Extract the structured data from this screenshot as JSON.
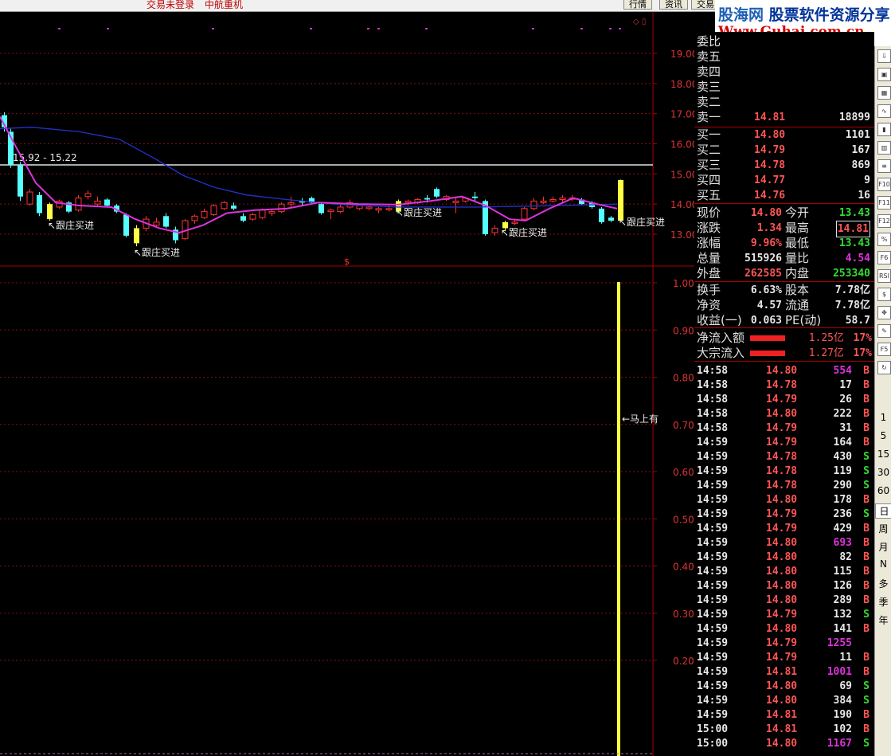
{
  "topbar": {
    "status_text": "交易未登录",
    "stock_name": "中航重机",
    "buttons": [
      "行情",
      "资讯",
      "交易"
    ]
  },
  "watermark": {
    "brand": "股海网",
    "slogan": "股票软件资源分享",
    "url": "Www.Guhai.com.cn"
  },
  "chart_data": [
    {
      "type": "candlestick",
      "yaxis_ticks": [
        "19.00",
        "18.00",
        "17.00",
        "16.00",
        "15.00",
        "14.00",
        "13.00"
      ],
      "ylim": [
        12.2,
        20.0
      ],
      "range_label": "15.92 - 15.22",
      "annotations": [
        "跟庄买进",
        "跟庄买进",
        "跟庄买进",
        "跟庄买进",
        "跟庄买进"
      ],
      "dollar_mark": "$"
    },
    {
      "type": "bar",
      "yaxis_ticks": [
        "1.00",
        "0.90",
        "0.80",
        "0.70",
        "0.60",
        "0.50",
        "0.40",
        "0.30",
        "0.20"
      ],
      "ylim": [
        0,
        1.05
      ],
      "signal_value": 1.0,
      "annotation": "←马上有"
    }
  ],
  "quote": {
    "header_label": "委比",
    "sells": [
      {
        "label": "卖五",
        "price": "",
        "vol": ""
      },
      {
        "label": "卖四",
        "price": "",
        "vol": ""
      },
      {
        "label": "卖三",
        "price": "",
        "vol": ""
      },
      {
        "label": "卖二",
        "price": "",
        "vol": ""
      },
      {
        "label": "卖一",
        "price": "14.81",
        "vol": "18899"
      }
    ],
    "buys": [
      {
        "label": "买一",
        "price": "14.80",
        "vol": "1101"
      },
      {
        "label": "买二",
        "price": "14.79",
        "vol": "167"
      },
      {
        "label": "买三",
        "price": "14.78",
        "vol": "869"
      },
      {
        "label": "买四",
        "price": "14.77",
        "vol": "9"
      },
      {
        "label": "买五",
        "price": "14.76",
        "vol": "16"
      }
    ],
    "stats": [
      {
        "l1": "现价",
        "v1": "14.80",
        "c1": "red",
        "l2": "今开",
        "v2": "13.43",
        "c2": "green"
      },
      {
        "l1": "涨跌",
        "v1": "1.34",
        "c1": "red",
        "l2": "最高",
        "v2": "14.81",
        "c2": "red"
      },
      {
        "l1": "涨幅",
        "v1": "9.96%",
        "c1": "red",
        "l2": "最低",
        "v2": "13.43",
        "c2": "green"
      },
      {
        "l1": "总量",
        "v1": "515926",
        "c1": "white",
        "l2": "量比",
        "v2": "4.54",
        "c2": "purple"
      },
      {
        "l1": "外盘",
        "v1": "262585",
        "c1": "red",
        "l2": "内盘",
        "v2": "253340",
        "c2": "green"
      }
    ],
    "fund": [
      {
        "l1": "换手",
        "v1": "6.63%",
        "l2": "股本",
        "v2": "7.78亿"
      },
      {
        "l1": "净资",
        "v1": "4.57",
        "l2": "流通",
        "v2": "7.78亿"
      },
      {
        "l1": "收益(一)",
        "v1": "0.063",
        "l2": "PE(动)",
        "v2": "58.7"
      }
    ],
    "flows": [
      {
        "label": "净流入额",
        "value": "1.25亿",
        "pct": "17%"
      },
      {
        "label": "大宗流入",
        "value": "1.27亿",
        "pct": "17%"
      }
    ],
    "ticks": [
      {
        "time": "14:58",
        "price": "14.80",
        "vol": "554",
        "bs": "B"
      },
      {
        "time": "14:58",
        "price": "14.78",
        "vol": "17",
        "bs": "B"
      },
      {
        "time": "14:58",
        "price": "14.79",
        "vol": "26",
        "bs": "B"
      },
      {
        "time": "14:58",
        "price": "14.80",
        "vol": "222",
        "bs": "B"
      },
      {
        "time": "14:58",
        "price": "14.79",
        "vol": "31",
        "bs": "B"
      },
      {
        "time": "14:59",
        "price": "14.79",
        "vol": "164",
        "bs": "B"
      },
      {
        "time": "14:59",
        "price": "14.78",
        "vol": "430",
        "bs": "S"
      },
      {
        "time": "14:59",
        "price": "14.78",
        "vol": "119",
        "bs": "S"
      },
      {
        "time": "14:59",
        "price": "14.78",
        "vol": "290",
        "bs": "S"
      },
      {
        "time": "14:59",
        "price": "14.80",
        "vol": "178",
        "bs": "B"
      },
      {
        "time": "14:59",
        "price": "14.79",
        "vol": "236",
        "bs": "S"
      },
      {
        "time": "14:59",
        "price": "14.79",
        "vol": "429",
        "bs": "B"
      },
      {
        "time": "14:59",
        "price": "14.80",
        "vol": "693",
        "bs": "B"
      },
      {
        "time": "14:59",
        "price": "14.80",
        "vol": "82",
        "bs": "B"
      },
      {
        "time": "14:59",
        "price": "14.80",
        "vol": "115",
        "bs": "B"
      },
      {
        "time": "14:59",
        "price": "14.80",
        "vol": "126",
        "bs": "B"
      },
      {
        "time": "14:59",
        "price": "14.80",
        "vol": "289",
        "bs": "B"
      },
      {
        "time": "14:59",
        "price": "14.79",
        "vol": "132",
        "bs": "S"
      },
      {
        "time": "14:59",
        "price": "14.80",
        "vol": "141",
        "bs": "B"
      },
      {
        "time": "14:59",
        "price": "14.79",
        "vol": "1255",
        "bs": ""
      },
      {
        "time": "14:59",
        "price": "14.79",
        "vol": "11",
        "bs": "B"
      },
      {
        "time": "14:59",
        "price": "14.81",
        "vol": "1001",
        "bs": "B"
      },
      {
        "time": "14:59",
        "price": "14.80",
        "vol": "69",
        "bs": "S"
      },
      {
        "time": "14:59",
        "price": "14.80",
        "vol": "384",
        "bs": "S"
      },
      {
        "time": "14:59",
        "price": "14.81",
        "vol": "190",
        "bs": "B"
      },
      {
        "time": "15:00",
        "price": "14.81",
        "vol": "102",
        "bs": "B"
      },
      {
        "time": "15:00",
        "price": "14.80",
        "vol": "1167",
        "bs": "S"
      }
    ]
  },
  "sidebar": {
    "periods": [
      "1",
      "5",
      "15",
      "30",
      "60",
      "日",
      "周",
      "月",
      "N",
      "多",
      "季",
      "年"
    ],
    "selected": "日",
    "icons": [
      "down-arrow-icon",
      "window-icon",
      "grid-icon",
      "line-chart-icon",
      "candle-icon",
      "multi-chart-icon",
      "list-icon",
      "f10-icon",
      "f11-icon",
      "f12-icon",
      "percent-icon",
      "f6-icon",
      "rsi-icon",
      "dollar-icon",
      "move-icon",
      "pencil-icon",
      "f5-icon",
      "refresh-icon"
    ]
  }
}
